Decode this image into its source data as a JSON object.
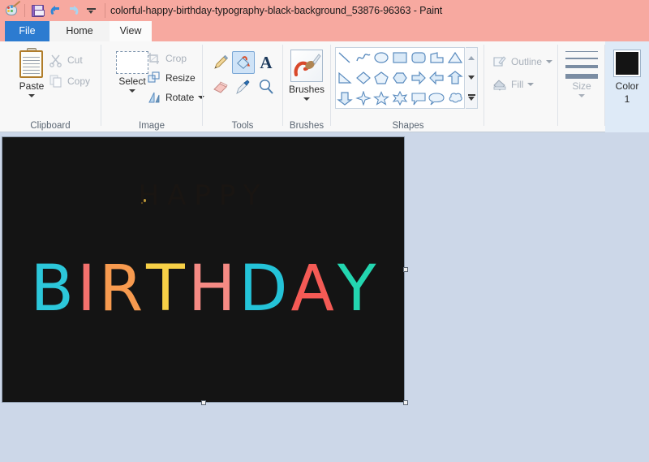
{
  "window": {
    "title": "colorful-happy-birthday-typography-black-background_53876-96363 - Paint",
    "titlebar_color": "#f7a9a0"
  },
  "quick_access": {
    "items": [
      {
        "name": "paint-logo-icon",
        "label": "Paint",
        "interactable": false
      },
      {
        "name": "save-icon",
        "label": "Save",
        "interactable": true
      },
      {
        "name": "undo-icon",
        "label": "Undo",
        "interactable": true
      },
      {
        "name": "redo-icon",
        "label": "Redo",
        "interactable": false
      },
      {
        "name": "customize-quick-access-icon",
        "label": "Customize Quick Access Toolbar",
        "interactable": true
      }
    ]
  },
  "tabs": [
    {
      "label": "File",
      "active": false,
      "style": "file"
    },
    {
      "label": "Home",
      "active": true,
      "style": "normal"
    },
    {
      "label": "View",
      "active": false,
      "style": "normal"
    }
  ],
  "ribbon": {
    "groups": [
      {
        "name": "clipboard",
        "label": "Clipboard",
        "big_button": {
          "label": "Paste",
          "icon": "clipboard-icon",
          "has_dropdown": true,
          "enabled": true
        },
        "small_buttons": [
          {
            "label": "Cut",
            "icon": "scissors-icon",
            "enabled": false
          },
          {
            "label": "Copy",
            "icon": "copy-icon",
            "enabled": false
          }
        ]
      },
      {
        "name": "image",
        "label": "Image",
        "big_button": {
          "label": "Select",
          "icon": "selection-rectangle-icon",
          "has_dropdown": true,
          "enabled": true
        },
        "small_buttons": [
          {
            "label": "Crop",
            "icon": "crop-icon",
            "enabled": false
          },
          {
            "label": "Resize",
            "icon": "resize-icon",
            "enabled": true
          },
          {
            "label": "Rotate",
            "icon": "rotate-icon",
            "enabled": true,
            "has_dropdown": true
          }
        ]
      },
      {
        "name": "tools",
        "label": "Tools",
        "tools": [
          {
            "name": "pencil-tool",
            "label": "Pencil",
            "selected": false
          },
          {
            "name": "fill-with-color-tool",
            "label": "Fill with color",
            "selected": true
          },
          {
            "name": "text-tool",
            "label": "Text",
            "selected": false
          },
          {
            "name": "eraser-tool",
            "label": "Eraser",
            "selected": false
          },
          {
            "name": "color-picker-tool",
            "label": "Color picker",
            "selected": false
          },
          {
            "name": "magnifier-tool",
            "label": "Magnifier",
            "selected": false
          }
        ]
      },
      {
        "name": "brushes",
        "label": "Brushes",
        "big_button": {
          "label": "Brushes",
          "icon": "paintbrush-icon",
          "has_dropdown": true,
          "enabled": true
        }
      },
      {
        "name": "shapes",
        "label": "Shapes",
        "shapes": [
          "line",
          "curve",
          "oval",
          "rectangle",
          "rounded-rectangle",
          "polygon",
          "triangle",
          "right-triangle",
          "diamond",
          "pentagon",
          "hexagon",
          "right-arrow",
          "left-arrow",
          "up-arrow",
          "down-arrow",
          "four-point-star",
          "five-point-star",
          "six-point-star",
          "rectangular-callout",
          "rounded-callout",
          "cloud-callout"
        ],
        "scroll_buttons": [
          "scroll-up",
          "scroll-down",
          "open-gallery"
        ]
      },
      {
        "name": "outline-fill",
        "label": "",
        "small_buttons": [
          {
            "label": "Outline",
            "icon": "outline-icon",
            "enabled": false,
            "has_dropdown": true
          },
          {
            "label": "Fill",
            "icon": "fill-icon",
            "enabled": false,
            "has_dropdown": true
          }
        ]
      },
      {
        "name": "size",
        "label": "Size",
        "big_button": {
          "label": "Size",
          "icon": "line-thickness-icon",
          "has_dropdown": true,
          "enabled": false
        }
      },
      {
        "name": "color",
        "label": "",
        "color1": {
          "label_line1": "Color",
          "label_line2": "1",
          "value": "#141414",
          "selected": true
        }
      }
    ]
  },
  "canvas": {
    "background": "#141414",
    "faint_word": "HAPPY",
    "word": "BIRTHDAY",
    "letters": [
      {
        "char": "B",
        "color": "#2cc7da"
      },
      {
        "char": "I",
        "color": "#f4716d"
      },
      {
        "char": "R",
        "color": "#f79a4f"
      },
      {
        "char": "T",
        "color": "#f7d046"
      },
      {
        "char": "H",
        "color": "#f58a84"
      },
      {
        "char": "D",
        "color": "#24c3d8"
      },
      {
        "char": "A",
        "color": "#f45a55"
      },
      {
        "char": "Y",
        "color": "#23d6b0"
      }
    ],
    "selection_handles": [
      {
        "name": "handle-right-middle"
      },
      {
        "name": "handle-bottom-right"
      },
      {
        "name": "handle-bottom-middle"
      }
    ]
  },
  "workspace": {
    "background": "#ccd7e8"
  }
}
